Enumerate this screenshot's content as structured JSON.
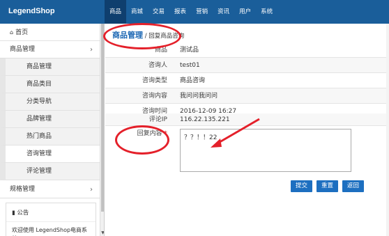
{
  "logo": "LegendShop",
  "nav": [
    "商品",
    "商城",
    "交易",
    "报表",
    "营销",
    "资讯",
    "用户",
    "系统"
  ],
  "sidebar": {
    "home": "首页",
    "groups": [
      {
        "label": "商品管理",
        "items": [
          "商品管理",
          "商品类目",
          "分类导航",
          "品牌管理",
          "热门商品",
          "咨询管理",
          "评论管理"
        ]
      },
      {
        "label": "规格管理"
      }
    ],
    "notice_title": "公告",
    "notice_text": "欢迎使用 LegendShop电商系统"
  },
  "breadcrumb": {
    "main": "商品管理",
    "sep": " / ",
    "sub": "回复商品咨询"
  },
  "form": {
    "rows": [
      {
        "label": "商品",
        "value": "测试品"
      },
      {
        "label": "咨询人",
        "value": "test01"
      },
      {
        "label": "咨询类型",
        "value": "商品咨询"
      },
      {
        "label": "咨询内容",
        "value": "我问问我问问"
      },
      {
        "label": "咨询时间",
        "value": "2016-12-09 16:27"
      },
      {
        "label": "评论IP",
        "value": "116.22.135.221"
      }
    ],
    "reply_label": "回复内容",
    "required_mark": "*",
    "reply_value": "？？！！22"
  },
  "buttons": {
    "submit": "提交",
    "reset": "重置",
    "back": "返回"
  },
  "colors": {
    "topbar": "#1a5e9a",
    "accent": "#1d6fc0",
    "annotation": "#e4202a"
  }
}
